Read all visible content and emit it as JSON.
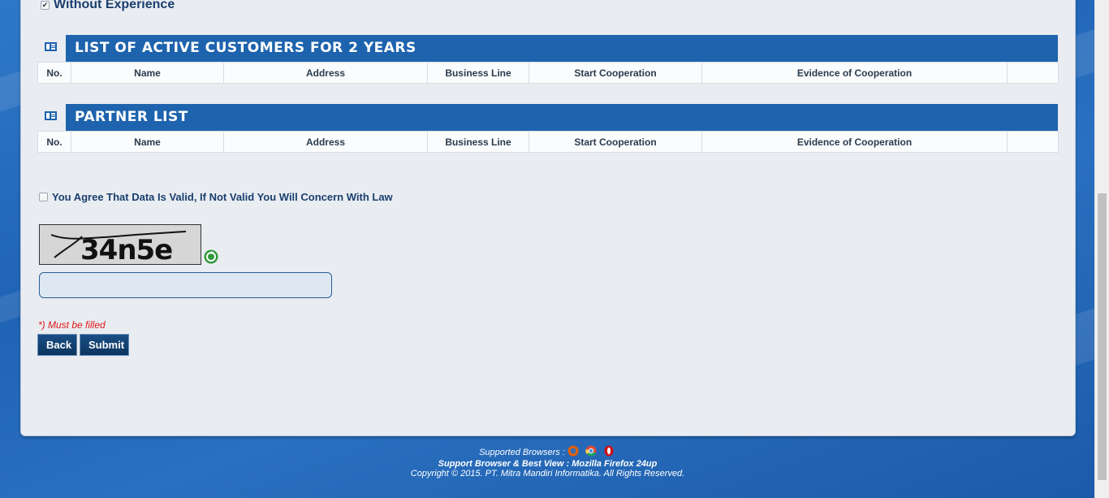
{
  "experience": {
    "label": "Without Experience",
    "checked": true
  },
  "customers": {
    "title": "LIST OF ACTIVE CUSTOMERS FOR 2 YEARS",
    "columns": [
      "No.",
      "Name",
      "Address",
      "Business Line",
      "Start Cooperation",
      "Evidence of Cooperation",
      ""
    ]
  },
  "partners": {
    "title": "PARTNER LIST",
    "columns": [
      "No.",
      "Name",
      "Address",
      "Business Line",
      "Start Cooperation",
      "Evidence of Cooperation",
      ""
    ]
  },
  "agreement": {
    "label": "You Agree That Data Is Valid, If Not Valid You Will Concern With Law",
    "checked": false
  },
  "captcha": {
    "text": "34n5e",
    "input_value": "",
    "refresh_icon": "refresh-icon"
  },
  "form": {
    "required_note": "*) Must be filled",
    "back_label": "Back",
    "submit_label": "Submit"
  },
  "footer": {
    "supported": "Supported Browsers :",
    "browser_icons": [
      "firefox-icon",
      "chrome-icon",
      "opera-icon"
    ],
    "best_view": "Support Browser & Best View : Mozilla Firefox 24up",
    "copyright": "Copyright © 2015. PT. Mitra Mandiri Informatika. All Rights Reserved."
  },
  "colors": {
    "header_bar": "#1e63ad",
    "button": "#0c355f",
    "required": "#e01616",
    "background": "#1f63b4"
  }
}
